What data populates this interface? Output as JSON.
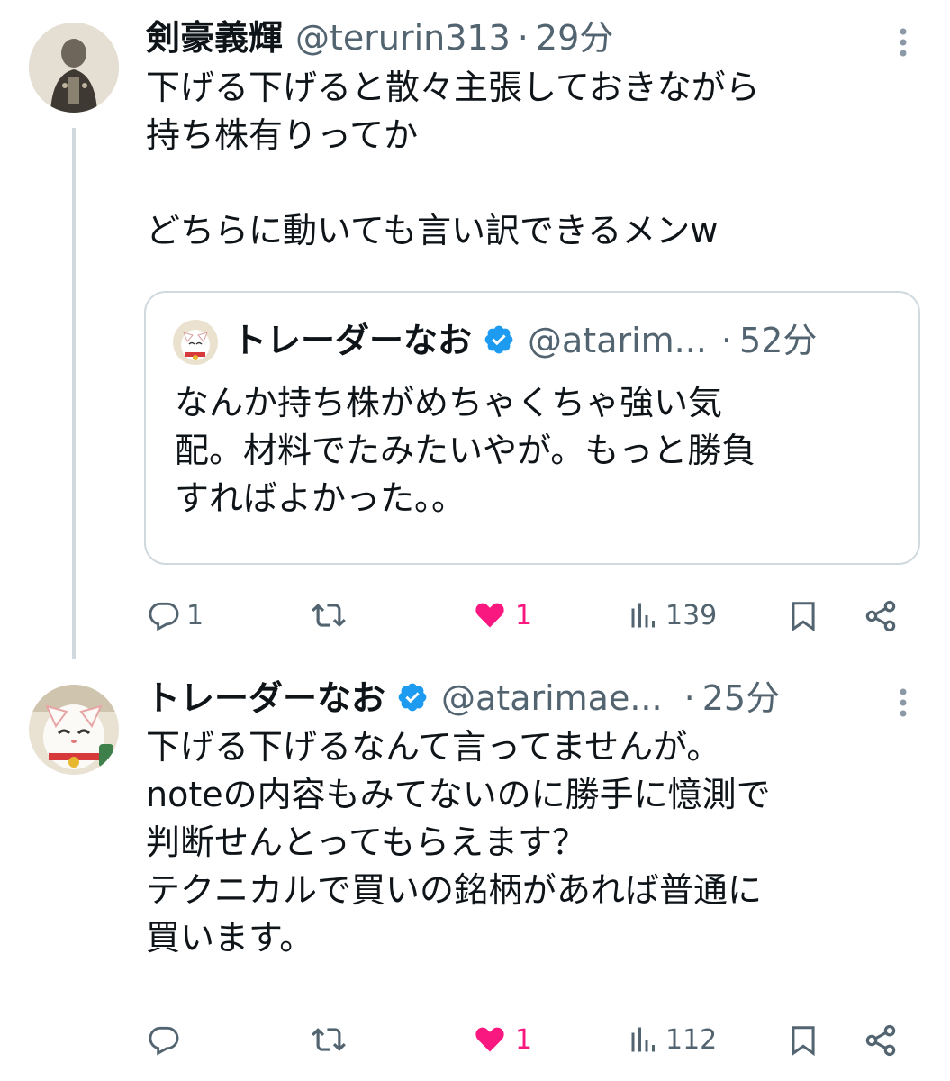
{
  "tweet1": {
    "name": "剣豪義輝",
    "handle": "@terurin313",
    "time": "29分",
    "text": "下げる下げると散々主張しておきながら\n持ち株有りってか\n\nどちらに動いても言い訳できるメンw",
    "quote": {
      "name": "トレーダーなお",
      "handle": "@atarim...",
      "time": "52分",
      "text": "なんか持ち株がめちゃくちゃ強い気\n配。材料でたみたいやが。もっと勝負\nすればよかった。。"
    },
    "actions": {
      "replies": "1",
      "retweets": "",
      "likes": "1",
      "views": "139"
    }
  },
  "tweet2": {
    "name": "トレーダーなお",
    "handle": "@atarimae...",
    "time": "25分",
    "text": "下げる下げるなんて言ってませんが。\nnoteの内容もみてないのに勝手に憶測で\n判断せんとってもらえます？\nテクニカルで買いの銘柄があれば普通に\n買います。",
    "actions": {
      "replies": "",
      "retweets": "",
      "likes": "1",
      "views": "112"
    }
  },
  "separator": "·",
  "colors": {
    "like": "#f91880",
    "verified": "#1d9bf0",
    "muted": "#536471",
    "border": "#cfd9de"
  }
}
